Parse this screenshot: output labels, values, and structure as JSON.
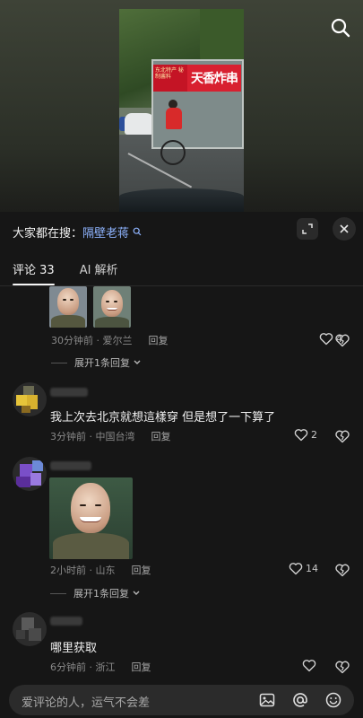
{
  "video": {
    "sign_big": "天香炸串",
    "sign_small": "东北特产 秘制酱料"
  },
  "header": {
    "trend_prefix": "大家都在搜：",
    "trend_keyword": "隔壁老蒋"
  },
  "tabs": [
    {
      "label": "评论 33",
      "active": true
    },
    {
      "label": "AI 解析",
      "active": false
    }
  ],
  "comments": [
    {
      "text": "",
      "time": "30分钟前",
      "location": "爱尔兰",
      "reply_label": "回复",
      "likes": "4",
      "expand_label": "展开1条回复"
    },
    {
      "text": "我上次去北京就想這樣穿 但是想了一下算了",
      "time": "3分钟前",
      "location": "中国台湾",
      "reply_label": "回复",
      "likes": "2"
    },
    {
      "text": "",
      "time": "2小时前",
      "location": "山东",
      "reply_label": "回复",
      "likes": "14",
      "expand_label": "展开1条回复"
    },
    {
      "text": "哪里获取",
      "time": "6分钟前",
      "location": "浙江",
      "reply_label": "回复",
      "likes": ""
    }
  ],
  "input": {
    "placeholder": "爱评论的人，运气不会差"
  },
  "icons": {
    "search": "search-icon",
    "expand": "expand-icon",
    "close": "close-icon",
    "like": "heart-icon",
    "dislike": "broken-heart-icon",
    "image": "image-icon",
    "mention": "at-icon",
    "emoji": "emoji-icon"
  },
  "colors": {
    "background": "#161616",
    "keyword": "#8fb4ff",
    "muted": "#8a8a8a"
  }
}
